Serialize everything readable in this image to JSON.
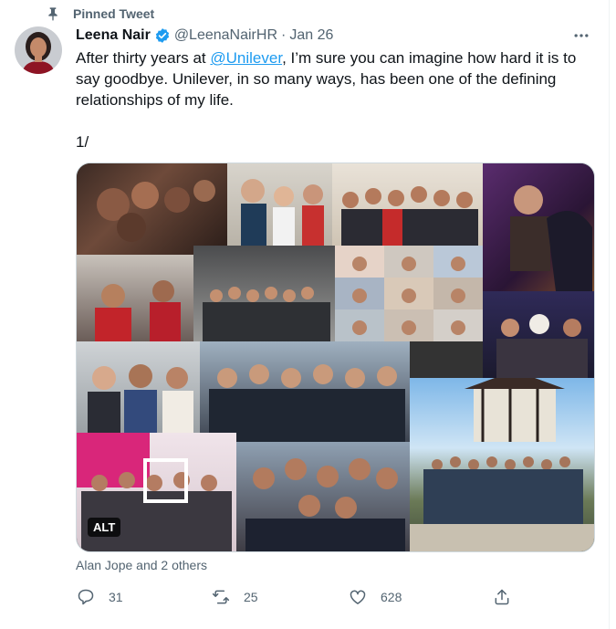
{
  "pinned_label": "Pinned Tweet",
  "author": {
    "name": "Leena Nair",
    "handle": "@LeenaNairHR",
    "date": "Jan 26"
  },
  "tweet": {
    "text_before": "After thirty years at ",
    "mention": "@Unilever",
    "text_after": ", I’m sure you can imagine how hard it is to say goodbye. Unilever, in so many ways, has been one of the defining relationships of my life.\n\n1/"
  },
  "media": {
    "alt_badge": "ALT"
  },
  "liked_by": "Alan Jope and 2 others",
  "actions": {
    "replies": "31",
    "retweets": "25",
    "likes": "628"
  },
  "colors": {
    "accent": "#1d9bf0",
    "secondary_text": "#536471",
    "primary_text": "#0f1419"
  },
  "icons": [
    "pin-icon",
    "verified-badge-icon",
    "more-icon",
    "reply-icon",
    "retweet-icon",
    "like-icon",
    "share-icon"
  ]
}
